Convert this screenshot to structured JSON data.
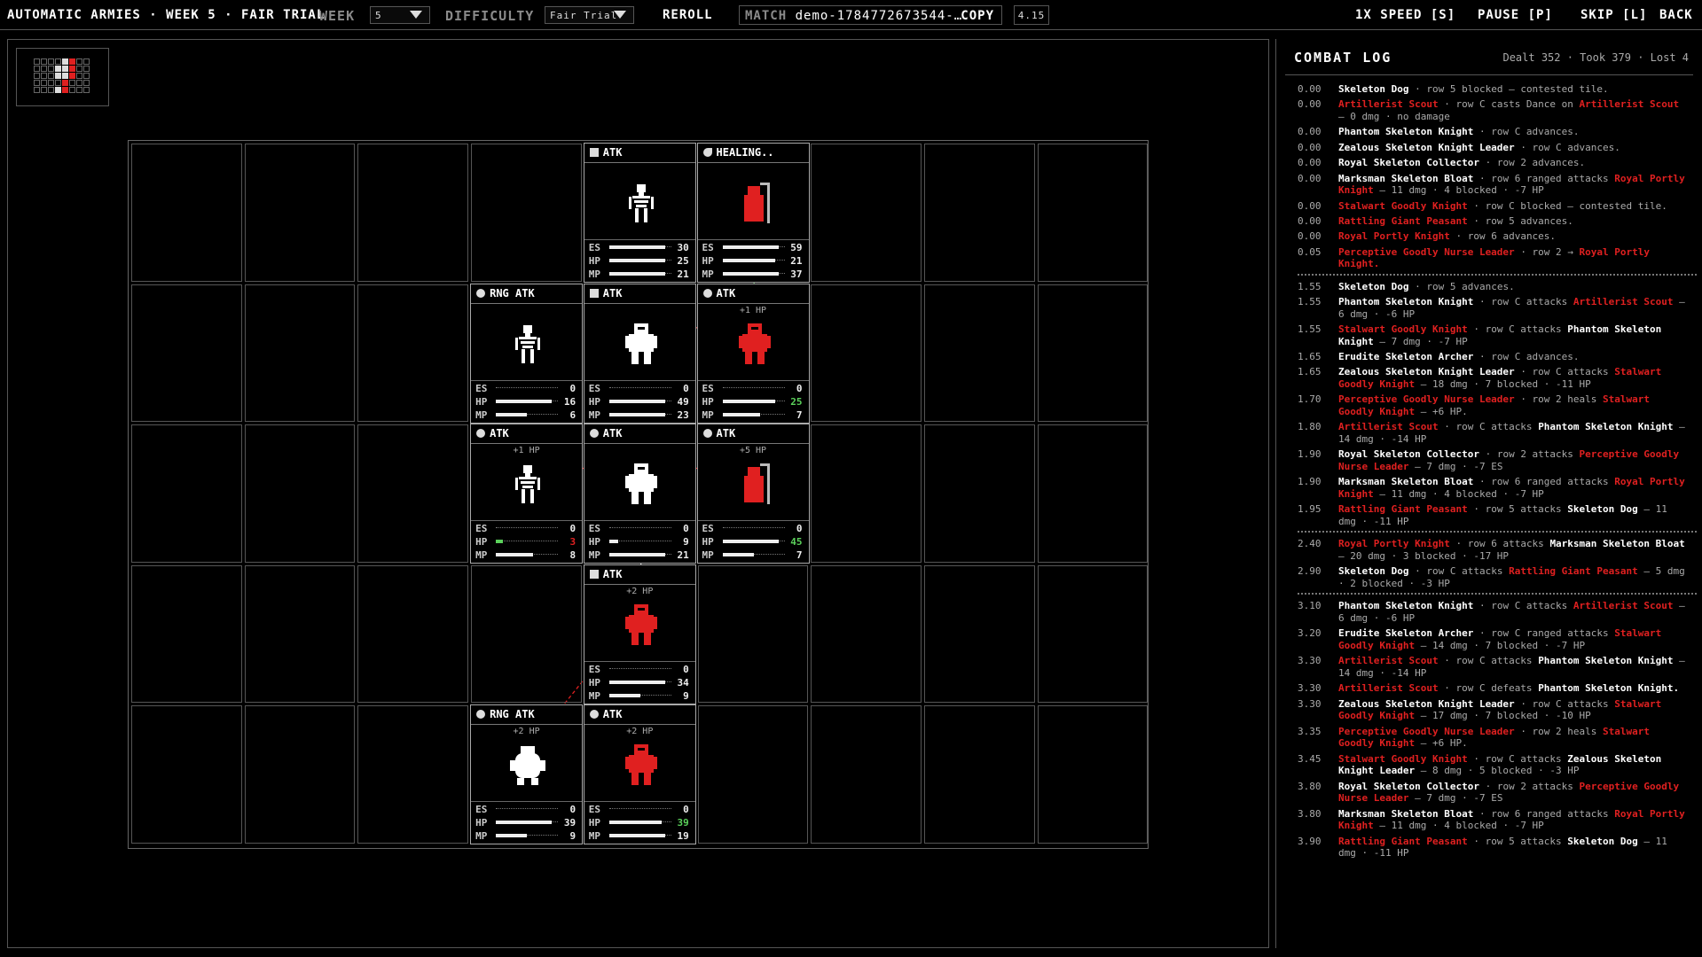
{
  "topbar": {
    "title": "AUTOMATIC ARMIES · WEEK 5 · FAIR TRIAL",
    "week_label": "WEEK",
    "week_value": "5",
    "difficulty_label": "DIFFICULTY",
    "difficulty_value": "Fair Trial",
    "reroll": "REROLL",
    "match_label": "MATCH",
    "match_value": "demo-1784772673544-…",
    "copy": "COPY",
    "version": "4.15",
    "speed": "1X SPEED [S]",
    "pause": "PAUSE [P]",
    "skip": "SKIP [L]",
    "back": "BACK"
  },
  "colors": {
    "enemy": "#e02020",
    "friendly": "#ffffff",
    "healing": "#5bd15b"
  },
  "units": [
    {
      "id": "u1",
      "intent": "ATK",
      "icon": "sword-icon",
      "side": "white",
      "pop": "",
      "es": "30",
      "hp": "25",
      "mp": "21",
      "es_f": 0.9,
      "hp_f": 0.9,
      "mp_f": 0.9
    },
    {
      "id": "u2",
      "intent": "HEALING..",
      "icon": "healing-icon",
      "side": "red",
      "pop": "",
      "es": "59",
      "hp": "21",
      "mp": "37",
      "es_f": 0.9,
      "hp_f": 0.85,
      "mp_f": 0.9
    },
    {
      "id": "u3",
      "intent": "RNG ATK",
      "icon": "bow-icon",
      "side": "white",
      "pop": "",
      "es": "0",
      "hp": "16",
      "mp": "6",
      "es_f": 0,
      "hp_f": 0.9,
      "mp_f": 0.5
    },
    {
      "id": "u4",
      "intent": "ATK",
      "icon": "sword-icon",
      "side": "white",
      "pop": "",
      "es": "0",
      "hp": "49",
      "mp": "23",
      "es_f": 0,
      "hp_f": 0.9,
      "mp_f": 0.9
    },
    {
      "id": "u5",
      "intent": "ATK",
      "icon": "clock-icon",
      "side": "red",
      "pop": "+1 HP",
      "es": "0",
      "hp": "25",
      "mp": "7",
      "es_f": 0,
      "hp_f": 0.85,
      "mp_f": 0.6
    },
    {
      "id": "u6",
      "intent": "ATK",
      "icon": "clock-icon",
      "side": "white",
      "pop": "+1 HP",
      "es": "0",
      "hp": "3",
      "mp": "8",
      "es_f": 0,
      "hp_f": 0.12,
      "mp_f": 0.6
    },
    {
      "id": "u7",
      "intent": "ATK",
      "icon": "clock-icon",
      "side": "white",
      "pop": "",
      "es": "0",
      "hp": "9",
      "mp": "21",
      "es_f": 0,
      "hp_f": 0.15,
      "mp_f": 0.9
    },
    {
      "id": "u8",
      "intent": "ATK",
      "icon": "clock-icon",
      "side": "red",
      "pop": "+5 HP",
      "es": "0",
      "hp": "45",
      "mp": "7",
      "es_f": 0,
      "hp_f": 0.9,
      "mp_f": 0.5
    },
    {
      "id": "u9",
      "intent": "ATK",
      "icon": "sword-icon",
      "side": "red",
      "pop": "+2 HP",
      "es": "0",
      "hp": "34",
      "mp": "9",
      "es_f": 0,
      "hp_f": 0.9,
      "mp_f": 0.5
    },
    {
      "id": "u10",
      "intent": "RNG ATK",
      "icon": "bow-icon",
      "side": "white",
      "pop": "+2 HP",
      "es": "0",
      "hp": "39",
      "mp": "9",
      "es_f": 0,
      "hp_f": 0.9,
      "mp_f": 0.5
    },
    {
      "id": "u11",
      "intent": "ATK",
      "icon": "clock-icon",
      "side": "red",
      "pop": "+2 HP",
      "es": "0",
      "hp": "39",
      "mp": "19",
      "es_f": 0,
      "hp_f": 0.85,
      "mp_f": 0.9
    }
  ],
  "log": {
    "title": "COMBAT LOG",
    "stats": "Dealt 352 · Took 379 · Lost 4",
    "entries": [
      {
        "t": "0.00",
        "parts": [
          [
            "w",
            "Skeleton Dog"
          ],
          [
            "",
            "· row 5 blocked — contested tile."
          ]
        ]
      },
      {
        "t": "0.00",
        "parts": [
          [
            "r",
            "Artillerist Scout"
          ],
          [
            "",
            "· row C casts Dance on"
          ],
          [
            "r",
            "Artillerist Scout"
          ],
          [
            "",
            "— 0 dmg · no damage"
          ]
        ]
      },
      {
        "t": "0.00",
        "parts": [
          [
            "w",
            "Phantom Skeleton Knight"
          ],
          [
            "",
            "· row C advances."
          ]
        ]
      },
      {
        "t": "0.00",
        "parts": [
          [
            "w",
            "Zealous Skeleton Knight Leader"
          ],
          [
            "",
            "· row C advances."
          ]
        ]
      },
      {
        "t": "0.00",
        "parts": [
          [
            "w",
            "Royal Skeleton Collector"
          ],
          [
            "",
            "· row 2 advances."
          ]
        ]
      },
      {
        "t": "0.00",
        "parts": [
          [
            "w",
            "Marksman Skeleton Bloat"
          ],
          [
            "",
            "· row 6 ranged attacks"
          ],
          [
            "r",
            "Royal Portly Knight"
          ],
          [
            "",
            "— 11 dmg · 4 blocked · -7 HP"
          ]
        ]
      },
      {
        "t": "0.00",
        "parts": [
          [
            "r",
            "Stalwart Goodly Knight"
          ],
          [
            "",
            "· row C blocked — contested tile."
          ]
        ]
      },
      {
        "t": "0.00",
        "parts": [
          [
            "r",
            "Rattling Giant Peasant"
          ],
          [
            "",
            "· row 5 advances."
          ]
        ]
      },
      {
        "t": "0.00",
        "parts": [
          [
            "r",
            "Royal Portly Knight"
          ],
          [
            "",
            "· row 6 advances."
          ]
        ]
      },
      {
        "t": "0.05",
        "parts": [
          [
            "r",
            "Perceptive Goodly Nurse Leader"
          ],
          [
            "",
            "· row 2 →"
          ],
          [
            "r",
            "Royal Portly Knight."
          ]
        ]
      },
      {
        "sep": true
      },
      {
        "t": "1.55",
        "parts": [
          [
            "w",
            "Skeleton Dog"
          ],
          [
            "",
            "· row 5 advances."
          ]
        ]
      },
      {
        "t": "1.55",
        "parts": [
          [
            "w",
            "Phantom Skeleton Knight"
          ],
          [
            "",
            "· row C attacks"
          ],
          [
            "r",
            "Artillerist Scout"
          ],
          [
            "",
            "— 6 dmg · -6 HP"
          ]
        ]
      },
      {
        "t": "1.55",
        "parts": [
          [
            "r",
            "Stalwart Goodly Knight"
          ],
          [
            "",
            "· row C attacks"
          ],
          [
            "w",
            "Phantom Skeleton Knight"
          ],
          [
            "",
            "— 7 dmg · -7 HP"
          ]
        ]
      },
      {
        "t": "1.65",
        "parts": [
          [
            "w",
            "Erudite Skeleton Archer"
          ],
          [
            "",
            "· row C advances."
          ]
        ]
      },
      {
        "t": "1.65",
        "parts": [
          [
            "w",
            "Zealous Skeleton Knight Leader"
          ],
          [
            "",
            "· row C attacks"
          ],
          [
            "r",
            "Stalwart Goodly Knight"
          ],
          [
            "",
            "— 18 dmg · 7 blocked · -11 HP"
          ]
        ]
      },
      {
        "t": "1.70",
        "parts": [
          [
            "r",
            "Perceptive Goodly Nurse Leader"
          ],
          [
            "",
            "· row 2 heals"
          ],
          [
            "r",
            "Stalwart Goodly Knight"
          ],
          [
            "",
            "— +6 HP."
          ]
        ]
      },
      {
        "t": "1.80",
        "parts": [
          [
            "r",
            "Artillerist Scout"
          ],
          [
            "",
            "· row C attacks"
          ],
          [
            "w",
            "Phantom Skeleton Knight"
          ],
          [
            "",
            "— 14 dmg · -14 HP"
          ]
        ]
      },
      {
        "t": "1.90",
        "parts": [
          [
            "w",
            "Royal Skeleton Collector"
          ],
          [
            "",
            "· row 2 attacks"
          ],
          [
            "r",
            "Perceptive Goodly Nurse Leader"
          ],
          [
            "",
            "— 7 dmg · -7 ES"
          ]
        ]
      },
      {
        "t": "1.90",
        "parts": [
          [
            "w",
            "Marksman Skeleton Bloat"
          ],
          [
            "",
            "· row 6 ranged attacks"
          ],
          [
            "r",
            "Royal Portly Knight"
          ],
          [
            "",
            "— 11 dmg · 4 blocked · -7 HP"
          ]
        ]
      },
      {
        "t": "1.95",
        "parts": [
          [
            "r",
            "Rattling Giant Peasant"
          ],
          [
            "",
            "· row 5 attacks"
          ],
          [
            "w",
            "Skeleton Dog"
          ],
          [
            "",
            "— 11 dmg · -11 HP"
          ]
        ]
      },
      {
        "sep": true
      },
      {
        "t": "2.40",
        "parts": [
          [
            "r",
            "Royal Portly Knight"
          ],
          [
            "",
            "· row 6 attacks"
          ],
          [
            "w",
            "Marksman Skeleton Bloat"
          ],
          [
            "",
            "— 20 dmg · 3 blocked · -17 HP"
          ]
        ]
      },
      {
        "t": "2.90",
        "parts": [
          [
            "w",
            "Skeleton Dog"
          ],
          [
            "",
            "· row C attacks"
          ],
          [
            "r",
            "Rattling Giant Peasant"
          ],
          [
            "",
            "— 5 dmg · 2 blocked · -3 HP"
          ]
        ]
      },
      {
        "sep": true
      },
      {
        "t": "3.10",
        "parts": [
          [
            "w",
            "Phantom Skeleton Knight"
          ],
          [
            "",
            "· row C attacks"
          ],
          [
            "r",
            "Artillerist Scout"
          ],
          [
            "",
            "— 6 dmg · -6 HP"
          ]
        ]
      },
      {
        "t": "3.20",
        "parts": [
          [
            "w",
            "Erudite Skeleton Archer"
          ],
          [
            "",
            "· row C ranged attacks"
          ],
          [
            "r",
            "Stalwart Goodly Knight"
          ],
          [
            "",
            "— 14 dmg · 7 blocked · -7 HP"
          ]
        ]
      },
      {
        "t": "3.30",
        "parts": [
          [
            "r",
            "Artillerist Scout"
          ],
          [
            "",
            "· row C attacks"
          ],
          [
            "w",
            "Phantom Skeleton Knight"
          ],
          [
            "",
            "— 14 dmg · -14 HP"
          ]
        ]
      },
      {
        "t": "3.30",
        "parts": [
          [
            "r",
            "Artillerist Scout"
          ],
          [
            "",
            "· row C defeats"
          ],
          [
            "w",
            "Phantom Skeleton Knight."
          ]
        ]
      },
      {
        "t": "3.30",
        "parts": [
          [
            "w",
            "Zealous Skeleton Knight Leader"
          ],
          [
            "",
            "· row C attacks"
          ],
          [
            "r",
            "Stalwart Goodly Knight"
          ],
          [
            "",
            "— 17 dmg · 7 blocked · -10 HP"
          ]
        ]
      },
      {
        "t": "3.35",
        "parts": [
          [
            "r",
            "Perceptive Goodly Nurse Leader"
          ],
          [
            "",
            "· row 2 heals"
          ],
          [
            "r",
            "Stalwart Goodly Knight"
          ],
          [
            "",
            "— +6 HP."
          ]
        ]
      },
      {
        "t": "3.45",
        "parts": [
          [
            "r",
            "Stalwart Goodly Knight"
          ],
          [
            "",
            "· row C attacks"
          ],
          [
            "w",
            "Zealous Skeleton Knight Leader"
          ],
          [
            "",
            "— 8 dmg · 5 blocked · -3 HP"
          ]
        ]
      },
      {
        "t": "3.80",
        "parts": [
          [
            "w",
            "Royal Skeleton Collector"
          ],
          [
            "",
            "· row 2 attacks"
          ],
          [
            "r",
            "Perceptive Goodly Nurse Leader"
          ],
          [
            "",
            "— 7 dmg · -7 ES"
          ]
        ]
      },
      {
        "t": "3.80",
        "parts": [
          [
            "w",
            "Marksman Skeleton Bloat"
          ],
          [
            "",
            "· row 6 ranged attacks"
          ],
          [
            "r",
            "Royal Portly Knight"
          ],
          [
            "",
            "— 11 dmg · 4 blocked · -7 HP"
          ]
        ]
      },
      {
        "t": "3.90",
        "parts": [
          [
            "r",
            "Rattling Giant Peasant"
          ],
          [
            "",
            "· row 5 attacks"
          ],
          [
            "w",
            "Skeleton Dog"
          ],
          [
            "",
            "— 11 dmg · -11 HP"
          ]
        ]
      }
    ]
  }
}
